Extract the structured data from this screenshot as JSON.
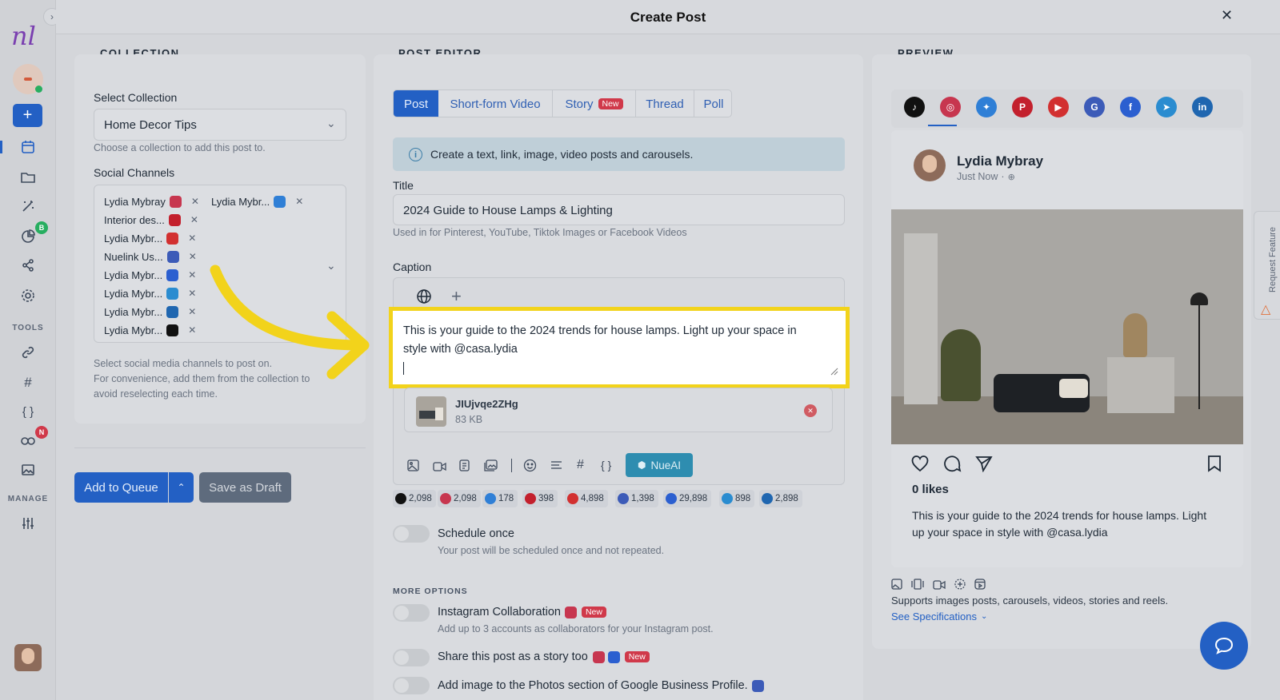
{
  "header": {
    "title": "Create Post"
  },
  "sidebar": {
    "logo": "nl",
    "tools_label": "TOOLS",
    "manage_label": "MANAGE",
    "analytics_badge": "B",
    "links_badge": "N"
  },
  "collection": {
    "section_title": "COLLECTION",
    "select_label": "Select Collection",
    "selected": "Home Decor Tips",
    "select_hint": "Choose a collection to add this post to.",
    "channels_label": "Social Channels",
    "channels": [
      {
        "name": "Lydia Mybray",
        "network": "instagram",
        "color": "#c7364f"
      },
      {
        "name": "Lydia Mybr...",
        "network": "bluesky",
        "color": "#2f7fd6"
      },
      {
        "name": "Interior des...",
        "network": "pinterest",
        "color": "#c3202d"
      },
      {
        "name": "Lydia Mybr...",
        "network": "youtube",
        "color": "#d23030"
      },
      {
        "name": "Nuelink Us...",
        "network": "google-business",
        "color": "#3c5bb8"
      },
      {
        "name": "Lydia Mybr...",
        "network": "facebook",
        "color": "#2b5fd0"
      },
      {
        "name": "Lydia Mybr...",
        "network": "telegram",
        "color": "#2a8cd0"
      },
      {
        "name": "Lydia Mybr...",
        "network": "linkedin",
        "color": "#1f66b0"
      },
      {
        "name": "Lydia Mybr...",
        "network": "tiktok",
        "color": "#111111"
      }
    ],
    "channels_hint_1": "Select social media channels to post on.",
    "channels_hint_2": "For convenience, add them from the collection to",
    "channels_hint_3": "avoid reselecting each time.",
    "add_to_queue": "Add to Queue",
    "save_as_draft": "Save as Draft"
  },
  "editor": {
    "section_title": "POST EDITOR",
    "tabs": [
      "Post",
      "Short-form Video",
      "Story",
      "Thread",
      "Poll"
    ],
    "story_badge": "New",
    "info_text": "Create a text, link, image, video posts and carousels.",
    "title_label": "Title",
    "title_value": "2024 Guide to House Lamps & Lighting",
    "title_hint": "Used in for Pinterest, YouTube, Tiktok Images or Facebook Videos",
    "caption_label": "Caption",
    "caption_line_1": "This is your guide to the 2024 trends for house lamps. Light up your space in",
    "caption_line_2": "style with @casa.lydia",
    "attachment_name": "JIUjvqe2ZHg",
    "attachment_size": "83 KB",
    "nueai_label": "NueAI",
    "counters": [
      {
        "value": "2,098",
        "network": "tiktok",
        "color": "#111111"
      },
      {
        "value": "2,098",
        "network": "instagram",
        "color": "#c7364f"
      },
      {
        "value": "178",
        "network": "bluesky",
        "color": "#2f7fd6"
      },
      {
        "value": "398",
        "network": "pinterest",
        "color": "#c3202d"
      },
      {
        "value": "4,898",
        "network": "youtube",
        "color": "#d23030"
      },
      {
        "value": "1,398",
        "network": "google-business",
        "color": "#3c5bb8"
      },
      {
        "value": "29,898",
        "network": "facebook",
        "color": "#2b5fd0"
      },
      {
        "value": "898",
        "network": "telegram",
        "color": "#2a8cd0"
      },
      {
        "value": "2,898",
        "network": "linkedin",
        "color": "#1f66b0"
      }
    ],
    "schedule_once": "Schedule once",
    "schedule_once_hint": "Your post will be scheduled once and not repeated.",
    "more_options": "MORE OPTIONS",
    "ig_collab": "Instagram Collaboration",
    "ig_collab_hint": "Add up to 3 accounts as collaborators for your Instagram post.",
    "share_story": "Share this post as a story too",
    "gbp_photos": "Add image to the Photos section of Google Business Profile.",
    "new_badge": "New"
  },
  "preview": {
    "section_title": "PREVIEW",
    "account_name": "Lydia Mybray",
    "timestamp": "Just Now",
    "likes": "0 likes",
    "caption": "This is your guide to the 2024 trends for house lamps. Light up your space in style with @casa.lydia",
    "caption_line_1": "This is your guide to the 2024 trends for house lamps. Light",
    "caption_line_2": "up your space in style with @casa.lydia",
    "supports": "Supports images posts, carousels, videos, stories and reels.",
    "see_specs": "See Specifications",
    "request_feature": "Request Feature"
  }
}
